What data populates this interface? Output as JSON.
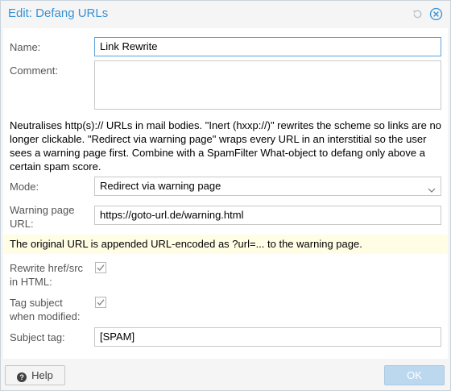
{
  "dialog": {
    "title": "Edit: Defang URLs",
    "icons": {
      "reset": "reset-icon",
      "close": "close-icon"
    }
  },
  "form": {
    "name_label": "Name:",
    "name_value": "Link Rewrite",
    "comment_label": "Comment:",
    "comment_value": "",
    "description": "Neutralises http(s):// URLs in mail bodies. \"Inert (hxxp://)\" rewrites the scheme so links are no longer clickable. \"Redirect via warning page\" wraps every URL in an interstitial so the user sees a warning page first. Combine with a SpamFilter What-object to defang only above a certain spam score.",
    "mode_label": "Mode:",
    "mode_value": "Redirect via warning page",
    "warning_url_label_line1": "Warning page",
    "warning_url_label_line2": "URL:",
    "warning_url_value": "https://goto-url.de/warning.html",
    "hint": "The original URL is appended URL-encoded as ?url=... to the warning page.",
    "rewrite_label_line1": "Rewrite href/src",
    "rewrite_label_line2": "in HTML:",
    "rewrite_checked": true,
    "tag_label_line1": "Tag subject",
    "tag_label_line2": "when modified:",
    "tag_checked": true,
    "subject_tag_label": "Subject tag:",
    "subject_tag_value": "[SPAM]"
  },
  "footer": {
    "help_label": "Help",
    "ok_label": "OK"
  },
  "colors": {
    "accent": "#3892d4",
    "hint_background": "#fffde4",
    "ok_disabled": "#bcd8ee"
  }
}
